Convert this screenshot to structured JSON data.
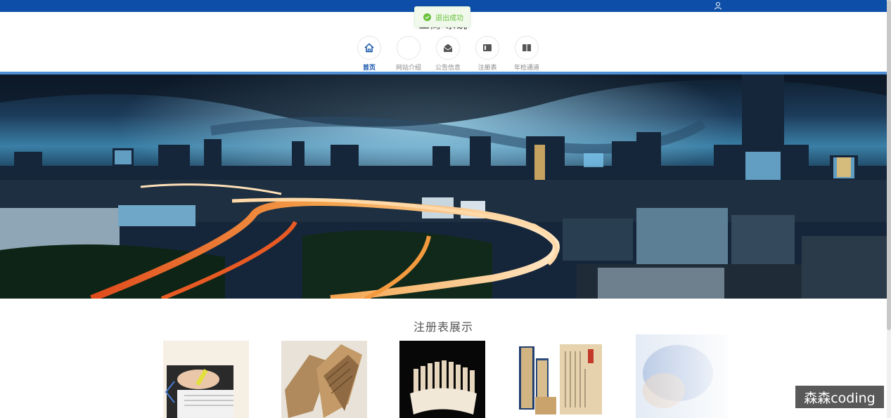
{
  "header": {
    "site_title": "工商          系统",
    "user_icon": "user-icon"
  },
  "toast": {
    "message": "退出成功",
    "icon": "check-circle-icon",
    "color": "#67c23a"
  },
  "nav": {
    "items": [
      {
        "label": "首页",
        "icon": "home-icon",
        "active": true
      },
      {
        "label": "网站介绍",
        "icon": "info-icon",
        "active": false
      },
      {
        "label": "公告信息",
        "icon": "mail-open-icon",
        "active": false
      },
      {
        "label": "注册表",
        "icon": "register-icon",
        "active": false
      },
      {
        "label": "年检通道",
        "icon": "book-icon",
        "active": false
      }
    ]
  },
  "section": {
    "title": "注册表展示",
    "cards": [
      {
        "image": "student-reading-image"
      },
      {
        "image": "ancient-scrolls-image"
      },
      {
        "image": "bamboo-slips-image"
      },
      {
        "image": "thread-bound-books-image"
      },
      {
        "image": "blurred-image"
      }
    ]
  },
  "watermark": {
    "text": "森森coding"
  },
  "colors": {
    "brand": "#0d4fa8",
    "accent_line": "#4f8fd6"
  }
}
